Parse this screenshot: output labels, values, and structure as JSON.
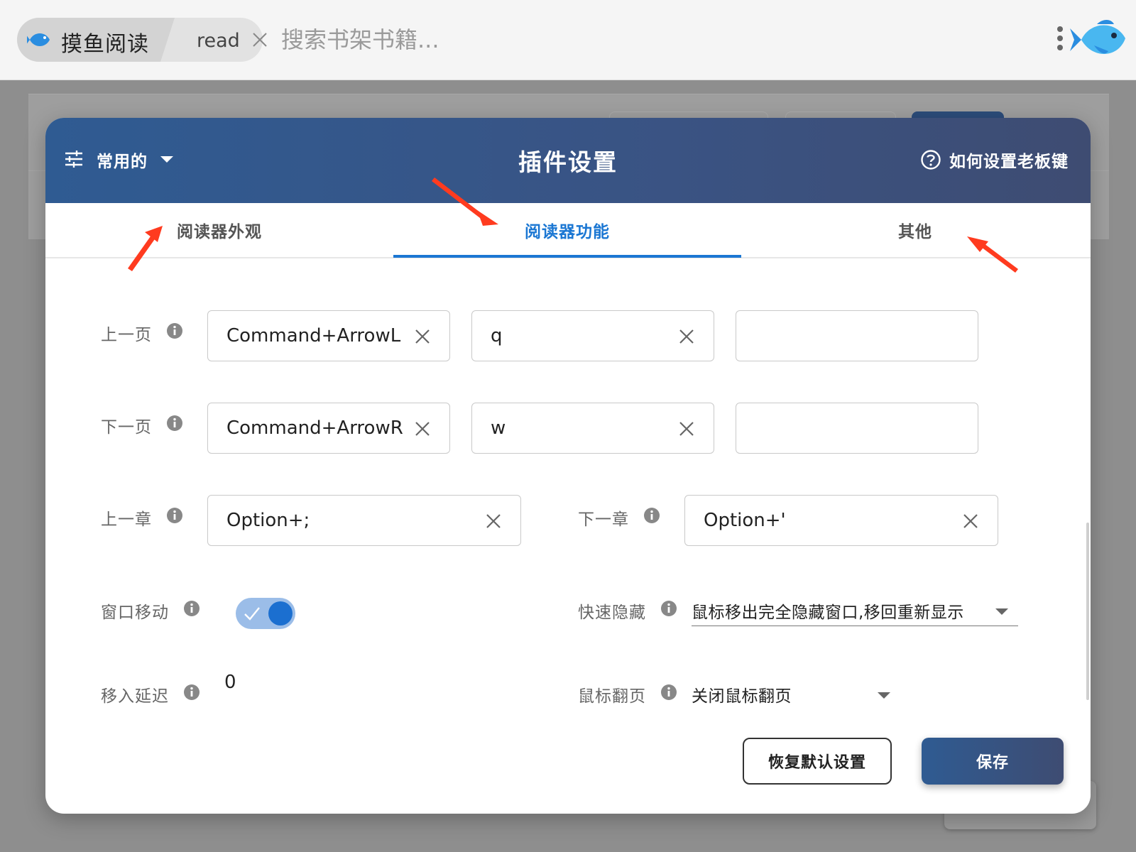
{
  "topbar": {
    "app_title": "摸鱼阅读",
    "tab_label": "read",
    "search_placeholder": "搜索书架书籍..."
  },
  "dialog": {
    "category": "常用的",
    "title": "插件设置",
    "help_link": "如何设置老板键",
    "tabs": [
      {
        "label": "阅读器外观",
        "active": false
      },
      {
        "label": "阅读器功能",
        "active": true
      },
      {
        "label": "其他",
        "active": false
      }
    ],
    "rows": {
      "prev_page": {
        "label": "上一页",
        "keys": [
          "Command+ArrowL",
          "q",
          ""
        ]
      },
      "next_page": {
        "label": "下一页",
        "keys": [
          "Command+ArrowR",
          "w",
          ""
        ]
      },
      "prev_chapter": {
        "label": "上一章",
        "key": "Option+;"
      },
      "next_chapter": {
        "label": "下一章",
        "key": "Option+'"
      },
      "window_move": {
        "label": "窗口移动",
        "enabled": true
      },
      "quick_hide": {
        "label": "快速隐藏",
        "value": "鼠标移出完全隐藏窗口,移回重新显示"
      },
      "move_in_delay": {
        "label": "移入延迟",
        "value": "0"
      },
      "mouse_flip": {
        "label": "鼠标翻页",
        "value": "关闭鼠标翻页"
      }
    },
    "buttons": {
      "reset": "恢复默认设置",
      "save": "保存"
    }
  },
  "colors": {
    "header_gradient_start": "#2f5b92",
    "header_gradient_end": "#3e4c72",
    "active_tab": "#1b77d3",
    "toggle_on": "#1b6fd0",
    "annotation_arrow": "#ff3b1f"
  }
}
